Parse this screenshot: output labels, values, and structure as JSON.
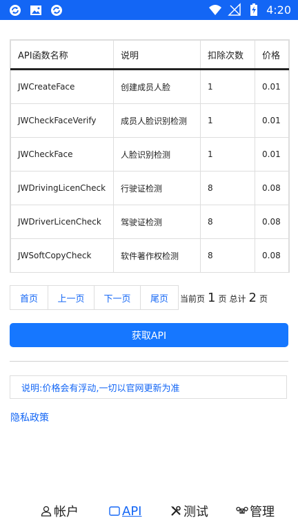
{
  "status_bar": {
    "time": "4:20",
    "left_icons": [
      "sync-icon",
      "image-icon",
      "sync-icon"
    ],
    "right_icons": [
      "wifi-icon",
      "signal-off-icon",
      "battery-charging-icon"
    ]
  },
  "table": {
    "headers": [
      "API函数名称",
      "说明",
      "扣除次数",
      "价格"
    ],
    "rows": [
      [
        "JWCreateFace",
        "创建成员人脸",
        "1",
        "0.01"
      ],
      [
        "JWCheckFaceVerify",
        "成员人脸识别检测",
        "1",
        "0.01"
      ],
      [
        "JWCheckFace",
        "人脸识别检测",
        "1",
        "0.01"
      ],
      [
        "JWDrivingLicenCheck",
        "行驶证检测",
        "8",
        "0.08"
      ],
      [
        "JWDriverLicenCheck",
        "驾驶证检测",
        "8",
        "0.08"
      ],
      [
        "JWSoftCopyCheck",
        "软件著作权检测",
        "8",
        "0.08"
      ]
    ]
  },
  "pagination": {
    "first": "首页",
    "prev": "上一页",
    "next": "下一页",
    "last": "尾页",
    "current_prefix": "当前页",
    "current_page": "1",
    "page_unit": "页",
    "total_prefix": "总计",
    "total_pages": "2",
    "total_unit": "页"
  },
  "get_api_button": "获取API",
  "notice": "说明:价格会有浮动,一切以官网更新为准",
  "privacy_link": "隐私政策",
  "bottom_nav": {
    "items": [
      {
        "icon": "user-icon",
        "label": "帐户",
        "active": false
      },
      {
        "icon": "square-icon",
        "label": "API",
        "active": true
      },
      {
        "icon": "tools-icon",
        "label": "测试",
        "active": false
      },
      {
        "icon": "command-icon",
        "label": "管理",
        "active": false
      }
    ]
  },
  "colors": {
    "status_bar": "#1366f5",
    "primary": "#1677ff",
    "link": "#1366f5"
  }
}
